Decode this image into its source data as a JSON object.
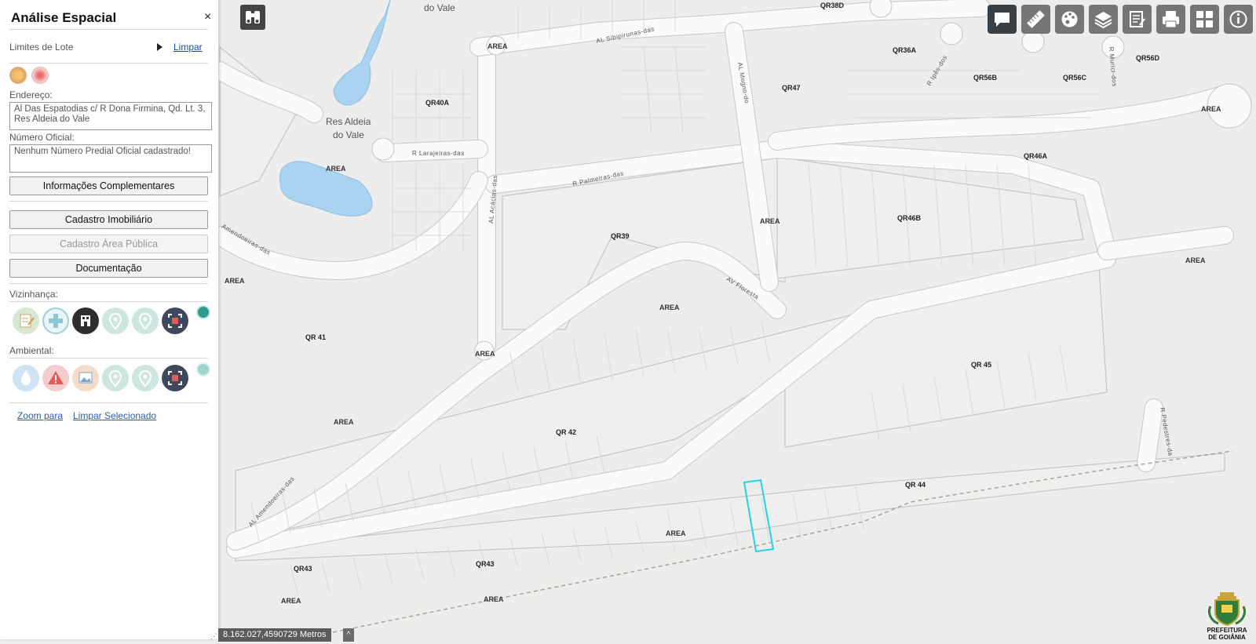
{
  "panel": {
    "title": "Análise Espacial",
    "close": "×",
    "limits_label": "Limites de Lote",
    "clear_link": "Limpar",
    "address_label": "Endereço:",
    "address_value": "Al Das Espatodias c/ R Dona Firmina, Qd. Lt. 3, Res Aldeia do Vale",
    "official_number_label": "Número Oficial:",
    "official_number_value": "Nenhum Número Predial Oficial cadastrado!",
    "info_button": "Informações Complementares",
    "cadastro_imobiliario": "Cadastro Imobiliário",
    "cadastro_area_publica": "Cadastro Área Pública",
    "documentacao": "Documentação",
    "vizinhanca_label": "Vizinhança:",
    "ambiental_label": "Ambiental:",
    "zoom_link": "Zoom para",
    "clear_selected_link": "Limpar Selecionado"
  },
  "vizinhanca_icons": [
    "edit-icon",
    "health-plus-icon",
    "building-icon",
    "location-pin-icon",
    "location-pin-icon",
    "fullscreen-icon"
  ],
  "ambiental_icons": [
    "water-drop-icon",
    "warning-icon",
    "image-icon",
    "location-pin-icon",
    "location-pin-icon",
    "fullscreen-icon"
  ],
  "toolbar": [
    "chat-icon",
    "ruler-icon",
    "palette-icon",
    "layers-icon",
    "report-icon",
    "print-icon",
    "grid-icon",
    "info-icon"
  ],
  "status": {
    "coordinates": "8.162.027,4590729 Metros",
    "toggle": "^"
  },
  "logo": {
    "line1": "PREFEITURA",
    "line2": "DE GOIÂNIA"
  },
  "map": {
    "places": [
      "do Vale",
      "Res Aldeia",
      "do Vale"
    ],
    "streets": [
      "AL Sibipirunas-das",
      "R Larajeiras-das",
      "R Palmeiras-das",
      "AL Acácias-das",
      "AV Floresta",
      "AL Amendoeiras-das",
      "AL Mogno-do",
      "R Murici-dos",
      "R Ipês-dos",
      "R Pedestres-da",
      "Amendoeiras-das"
    ],
    "blocks": [
      "QR38D",
      "QR36A",
      "QR56D",
      "QR56B",
      "QR56C",
      "QR47",
      "QR40A",
      "QR46A",
      "QR46B",
      "QR39",
      "QR 41",
      "QR 45",
      "QR 42",
      "QR 44",
      "QR43",
      "QR43"
    ],
    "areas": [
      "AREA",
      "AREA",
      "AREA",
      "AREA",
      "AREA",
      "AREA",
      "AREA",
      "AREA",
      "AREA",
      "AREA",
      "AREA",
      "AREA"
    ]
  },
  "colors": {
    "selected_lot": "#22d3e0",
    "toolbar_active": "#3a3f44",
    "toolbar": "#767676"
  }
}
